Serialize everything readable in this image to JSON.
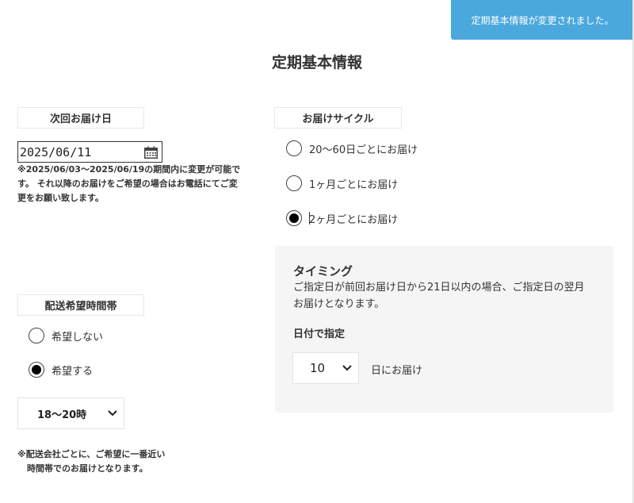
{
  "toast": {
    "message": "定期基本情報が変更されました。"
  },
  "page": {
    "title": "定期基本情報"
  },
  "next_delivery": {
    "label": "次回お届け日",
    "date_value": "2025/06/11",
    "note_line1": "※2025/06/03～2025/06/19の期間内に変更が可能で",
    "note_line2": "す。 それ以降のお届けをご希望の場合はお電話にてご変",
    "note_line3": "更をお願い致します。"
  },
  "delivery_cycle": {
    "label": "お届けサイクル",
    "options": [
      {
        "label": "20～60日ごとにお届け",
        "selected": false
      },
      {
        "label": "1ヶ月ごとにお届け",
        "selected": false
      },
      {
        "label": "2ヶ月ごとにお届け",
        "selected": true
      }
    ]
  },
  "timing": {
    "title": "タイミング",
    "desc_line1": "ご指定日が前回お届け日から21日以内の場合、ご指定日の翌月",
    "desc_line2": "お届けとなります。",
    "date_spec_label": "日付で指定",
    "day_value": "10",
    "day_suffix": "日にお届け"
  },
  "delivery_time": {
    "label": "配送希望時間帯",
    "options": [
      {
        "label": "希望しない",
        "selected": false
      },
      {
        "label": "希望する",
        "selected": true
      }
    ],
    "time_value": "18～20時",
    "note_line1": "※配送会社ごとに、ご希望に一番近い",
    "note_line2": "時間帯でのお届けとなります。"
  },
  "icons": {
    "calendar": "calendar-icon",
    "chevron": "chevron-down-icon"
  },
  "colors": {
    "toast_bg": "#4aa8dc",
    "panel_bg": "#f5f5f5",
    "text": "#333333"
  }
}
